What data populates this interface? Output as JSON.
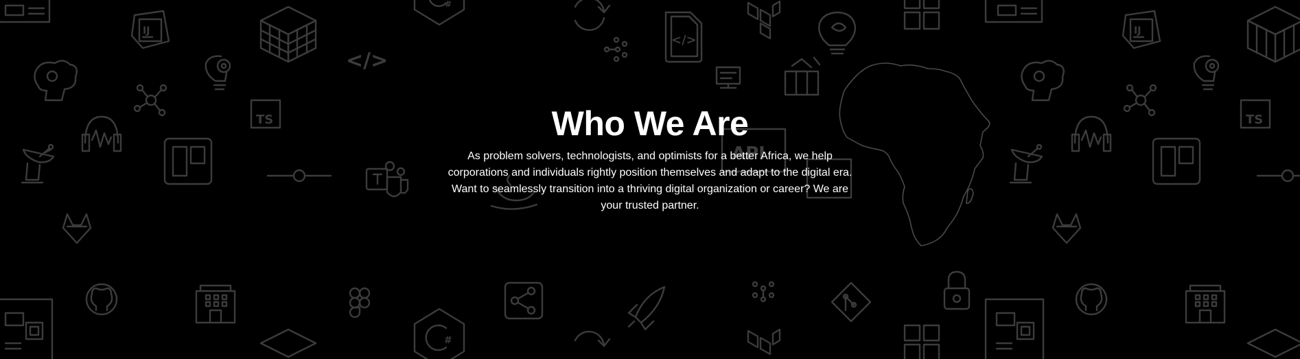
{
  "section": {
    "title": "Who We Are",
    "description": "As problem solvers, technologists, and optimists for a better Africa, we help corporations and individuals rightly position themselves and adapt to the digital era. Want to seamlessly transition into a thriving digital organization or career? We are your trusted partner."
  },
  "background": {
    "color": "#000000",
    "icon_color": "#3c3c3c",
    "icons": [
      "motherboard-icon",
      "intellij-icon",
      "rubiks-cube-icon",
      "csharp-icon",
      "refresh-icon",
      "code-file-icon",
      "terraform-icon",
      "lightbulb-icon",
      "windows-icon",
      "brain-icon",
      "lightbulb-gear-icon",
      "code-icon",
      "network-icon",
      "git-graph-icon",
      "monitor-icon",
      "puzzle-icon",
      "typescript-icon",
      "headphones-icon",
      "satellite-dish-icon",
      "trello-icon",
      "slider-icon",
      "teams-icon",
      "api-icon",
      "java-icon",
      "gitlab-icon",
      "github-icon",
      "building-icon",
      "figma-icon",
      "share-icon",
      "rocket-icon",
      "lock-icon",
      "git-icon",
      "africa-map-icon"
    ]
  }
}
